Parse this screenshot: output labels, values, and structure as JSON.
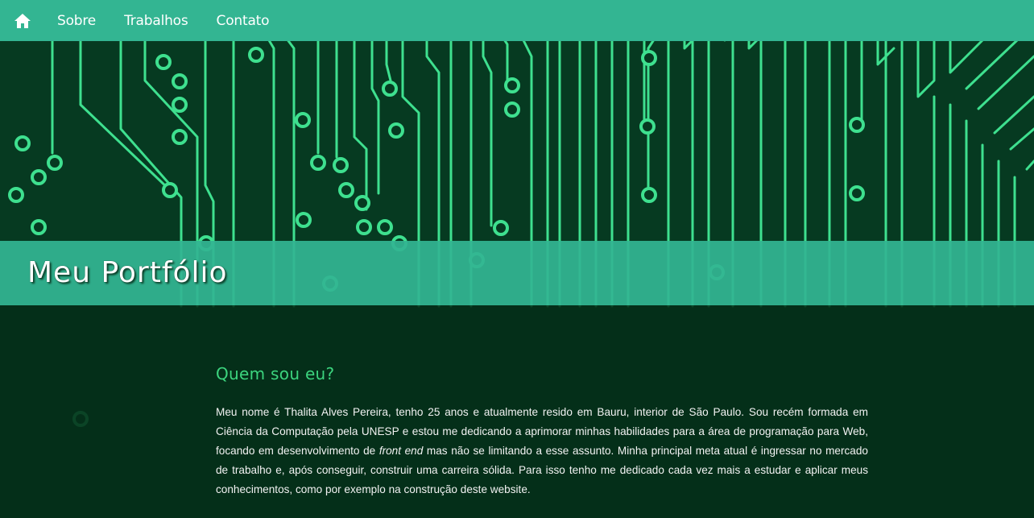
{
  "nav": {
    "home_icon": "home-icon",
    "items": [
      {
        "label": "Sobre"
      },
      {
        "label": "Trabalhos"
      },
      {
        "label": "Contato"
      }
    ]
  },
  "hero": {
    "title": "Meu Portfólio"
  },
  "about": {
    "heading": "Quem sou eu?",
    "text_before": "Meu nome é Thalita Alves Pereira, tenho 25 anos e atualmente resido em Bauru, interior de São Paulo. Sou recém formada em Ciência da Computação pela UNESP e estou me dedicando a aprimorar minhas habilidades para a área de programação para Web, focando em desenvolvimento de ",
    "text_emphasis": "front end",
    "text_after": " mas não se limitando a esse assunto. Minha principal meta atual é ingressar no mercado de trabalho e, após conseguir, construir uma carreira sólida. Para isso tenho me dedicado cada vez mais a estudar e aplicar meus conhecimentos, como por exemplo na construção deste website."
  },
  "colors": {
    "nav_bg": "#33b592",
    "page_bg": "#052e1a",
    "trace": "#3ee08f",
    "heading": "#3cd47e"
  }
}
